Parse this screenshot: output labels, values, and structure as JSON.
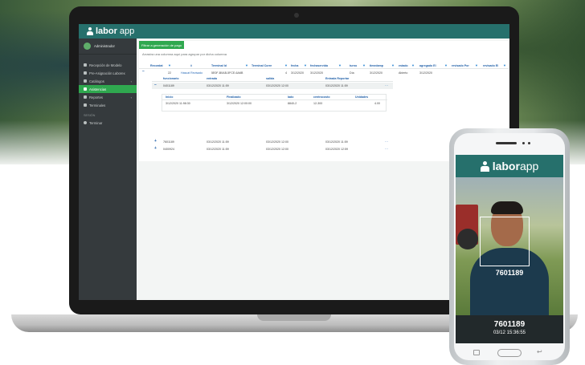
{
  "brand": {
    "logo_text_bold": "labor",
    "logo_text_light": "app"
  },
  "sidebar": {
    "user": "Administrador",
    "items": [
      {
        "label": "Recepción de Modelo",
        "chevron": ""
      },
      {
        "label": "Pre-Asignación Laborex",
        "chevron": ""
      },
      {
        "label": "Catálogos",
        "chevron": "‹"
      },
      {
        "label": "Asistencias",
        "chevron": ""
      },
      {
        "label": "Reportes",
        "chevron": "‹"
      },
      {
        "label": "Terminales",
        "chevron": ""
      }
    ],
    "section": "SESIÓN",
    "bottom_items": [
      {
        "label": "Terminar"
      }
    ]
  },
  "main": {
    "export_label": "Filtrar a generación de pago",
    "group_hint": "Arrastra una columna aquí para agrupar por dicha columna",
    "columns": [
      "Recordat",
      "#",
      "Terminal Id",
      "Terminal Corre",
      "fecha",
      "fechaservida",
      "turno",
      "timedamp",
      "estado",
      "agregado El",
      "revisado Por",
      "revisado El"
    ],
    "row": {
      "sign": "−",
      "num": "22",
      "name": "Hascat Revisado",
      "terminal": "5E0F-B0AB-5FCE-6A6B",
      "count": "4",
      "fecha": "3/12/2020",
      "fechaservida": "3/12/2020",
      "turno": "Día",
      "timedamp": "3/12/2020",
      "estado": "Abierto",
      "agregado": "3/12/2020"
    },
    "detail": {
      "columns": [
        "funcionario",
        "entrada",
        "salida",
        "Entrada Reportar"
      ],
      "rows": [
        {
          "sign": "−",
          "id": "0401189",
          "entrada": "03/12/2020 11:59",
          "salida": "03/12/2020 12:00",
          "reportar": "03/12/2020 11:59"
        },
        {
          "sign": "+",
          "id": "7601189",
          "entrada": "03/12/2020 11:59",
          "salida": "03/12/2020 12:00",
          "reportar": "03/12/2020 11:59"
        },
        {
          "sign": "+",
          "id": "0400924",
          "entrada": "03/12/2020 11:59",
          "salida": "03/12/2020 12:00",
          "reportar": "03/12/2020 12:59"
        }
      ],
      "sub": {
        "columns": [
          "Inicio",
          "Finalizado",
          "lado",
          "centrocosto",
          "Unidades"
        ],
        "row": {
          "inicio": "3/12/2020 11:98:30",
          "fin": "3/12/2020 12:00:00",
          "lado": "8840-2",
          "cc": "12-300",
          "unidades": "4.00"
        }
      },
      "more": "⋯"
    }
  },
  "phone": {
    "face_id": "7601189",
    "id": "7601189",
    "timestamp": "03/12 15:36:55"
  },
  "colors": {
    "brand_teal": "#26706c",
    "accent_green": "#2fa84f",
    "sidebar": "#353a3d"
  },
  "icons": [
    "filter-icon",
    "user-avatar-icon",
    "logo-person-icon"
  ]
}
